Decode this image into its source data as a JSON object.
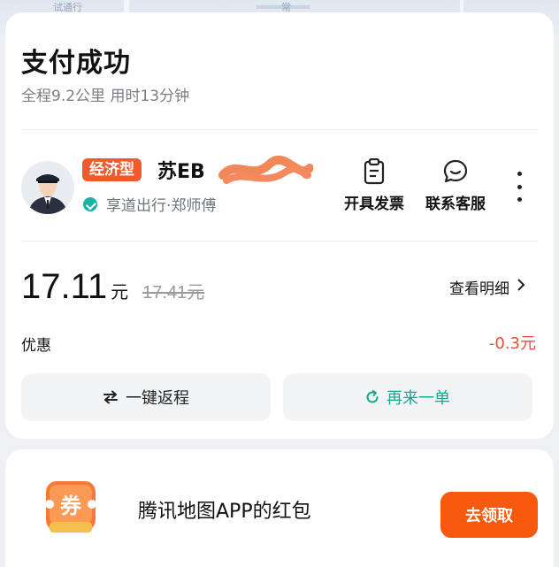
{
  "map": {
    "label_left": "试通行",
    "label_center": "常"
  },
  "header": {
    "title": "支付成功",
    "subtitle": "全程9.2公里 用时13分钟"
  },
  "driver": {
    "badge": "经济型",
    "plate": "苏EB",
    "company": "享道出行·郑师傅"
  },
  "actions": {
    "invoice_label": "开具发票",
    "service_label": "联系客服"
  },
  "fare": {
    "amount": "17.11",
    "unit": "元",
    "original_amount": "17.41",
    "original_unit": "元",
    "detail_link": "查看明细",
    "discount_label": "优惠",
    "discount_value": "-0.3元"
  },
  "buttons": {
    "return_label": "一键返程",
    "reorder_label": "再来一单"
  },
  "coupon": {
    "icon_text": "券",
    "text": "腾讯地图APP的红包",
    "claim_label": "去领取"
  },
  "colors": {
    "accent_orange": "#f7590f",
    "badge": "#f25a2b",
    "discount_red": "#f04b3a",
    "reorder_green": "#14a88e"
  }
}
